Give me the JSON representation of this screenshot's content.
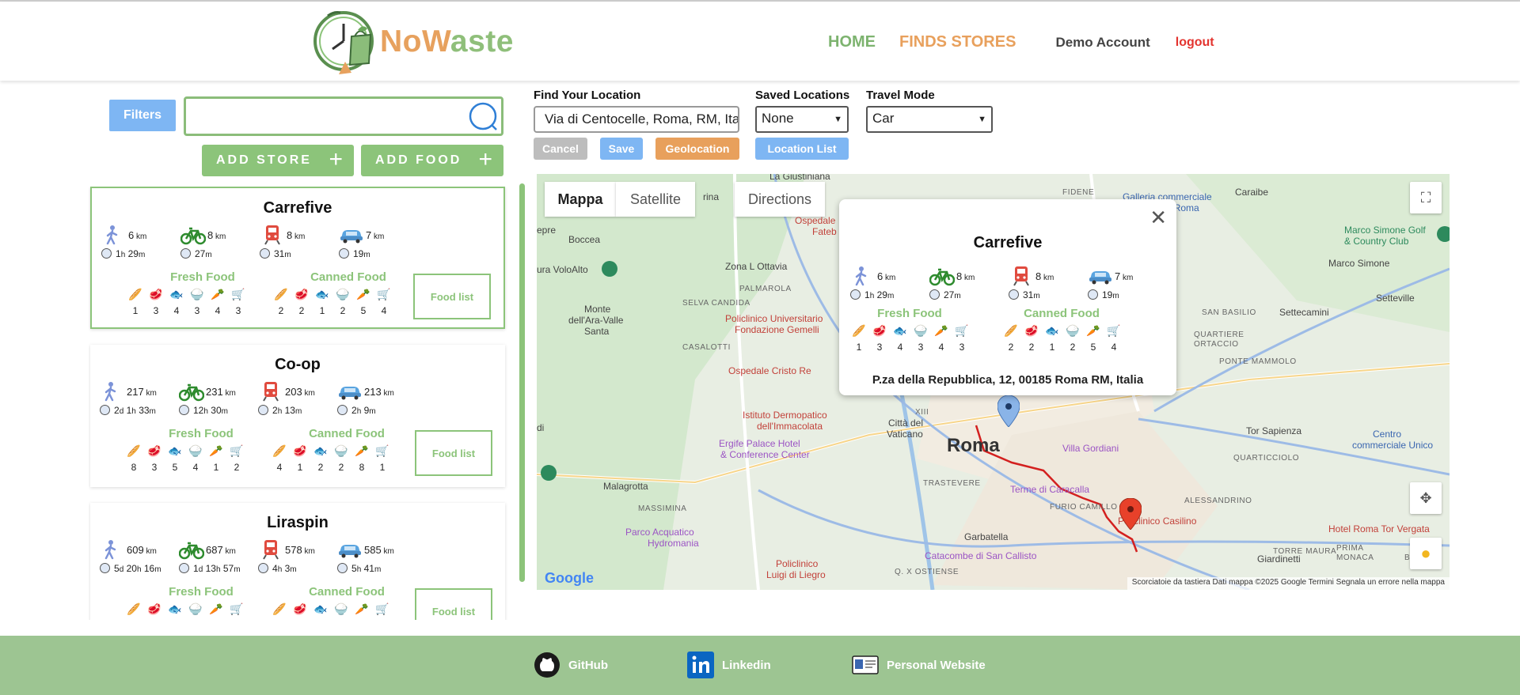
{
  "header": {
    "logo_part1": "No",
    "logo_part2": "W",
    "logo_part3": "aste",
    "nav_home": "HOME",
    "nav_finds": "FINDS STORES",
    "account": "Demo Account",
    "logout": "logout"
  },
  "sidebar": {
    "filters_label": "Filters",
    "search_value": "",
    "add_store": "ADD STORE",
    "add_food": "ADD FOOD",
    "food_list_label": "Food list",
    "fresh_label": "Fresh Food",
    "canned_label": "Canned Food"
  },
  "stores": [
    {
      "name": "Carrefive",
      "walk": {
        "d": "6",
        "u": "km",
        "t1": "1",
        "u1": "h",
        "t2": "29",
        "u2": "m",
        "t3": "",
        "u3": ""
      },
      "bike": {
        "d": "8",
        "u": "km",
        "t1": "27",
        "u1": "m",
        "t2": "",
        "u2": "",
        "t3": "",
        "u3": ""
      },
      "train": {
        "d": "8",
        "u": "km",
        "t1": "31",
        "u1": "m",
        "t2": "",
        "u2": "",
        "t3": "",
        "u3": ""
      },
      "car": {
        "d": "7",
        "u": "km",
        "t1": "19",
        "u1": "m",
        "t2": "",
        "u2": "",
        "t3": "",
        "u3": ""
      },
      "fresh": [
        "1",
        "3",
        "4",
        "3",
        "4",
        "3"
      ],
      "canned": [
        "2",
        "2",
        "1",
        "2",
        "5",
        "4"
      ]
    },
    {
      "name": "Co-op",
      "walk": {
        "d": "217",
        "u": "km",
        "t1": "2",
        "u1": "d",
        "t2": "1",
        "u2": "h",
        "t3": "33",
        "u3": "m"
      },
      "bike": {
        "d": "231",
        "u": "km",
        "t1": "12",
        "u1": "h",
        "t2": "30",
        "u2": "m",
        "t3": "",
        "u3": ""
      },
      "train": {
        "d": "203",
        "u": "km",
        "t1": "2",
        "u1": "h",
        "t2": "13",
        "u2": "m",
        "t3": "",
        "u3": ""
      },
      "car": {
        "d": "213",
        "u": "km",
        "t1": "2",
        "u1": "h",
        "t2": "9",
        "u2": "m",
        "t3": "",
        "u3": ""
      },
      "fresh": [
        "8",
        "3",
        "5",
        "4",
        "1",
        "2"
      ],
      "canned": [
        "4",
        "1",
        "2",
        "2",
        "8",
        "1"
      ]
    },
    {
      "name": "Liraspin",
      "walk": {
        "d": "609",
        "u": "km",
        "t1": "5",
        "u1": "d",
        "t2": "20",
        "u2": "h",
        "t3": "16",
        "u3": "m"
      },
      "bike": {
        "d": "687",
        "u": "km",
        "t1": "1",
        "u1": "d",
        "t2": "13",
        "u2": "h",
        "t3": "57",
        "u3": "m"
      },
      "train": {
        "d": "578",
        "u": "km",
        "t1": "4",
        "u1": "h",
        "t2": "3",
        "u2": "m",
        "t3": "",
        "u3": ""
      },
      "car": {
        "d": "585",
        "u": "km",
        "t1": "5",
        "u1": "h",
        "t2": "41",
        "u2": "m",
        "t3": "",
        "u3": ""
      },
      "fresh": [
        "",
        "",
        "",
        "",
        "",
        ""
      ],
      "canned": [
        "",
        "",
        "",
        "",
        "",
        ""
      ]
    }
  ],
  "location": {
    "find_label": "Find Your Location",
    "find_value": "Via di Centocelle, Roma, RM, Italia",
    "saved_label": "Saved Locations",
    "saved_value": "None",
    "travel_label": "Travel Mode",
    "travel_value": "Car",
    "cancel": "Cancel",
    "save": "Save",
    "geolocation": "Geolocation",
    "location_list": "Location List"
  },
  "map": {
    "tab_map": "Mappa",
    "tab_satellite": "Satellite",
    "tab_directions": "Directions",
    "popup": {
      "name": "Carrefive",
      "walk": {
        "d": "6",
        "u": "km",
        "t1": "1",
        "u1": "h",
        "t2": "29",
        "u2": "m"
      },
      "bike": {
        "d": "8",
        "u": "km",
        "t1": "27",
        "u1": "m"
      },
      "train": {
        "d": "8",
        "u": "km",
        "t1": "31",
        "u1": "m"
      },
      "car": {
        "d": "7",
        "u": "km",
        "t1": "19",
        "u1": "m"
      },
      "fresh": [
        "1",
        "3",
        "4",
        "3",
        "4",
        "3"
      ],
      "canned": [
        "2",
        "2",
        "1",
        "2",
        "5",
        "4"
      ],
      "address": "P.za della Repubblica, 12, 00185 Roma RM, Italia"
    },
    "labels": {
      "la_giustiniana": "La Giustiniana",
      "fidene": "FIDENE",
      "galleria": "Galleria commerciale",
      "galleria2": "Porta di Roma",
      "caraibe": "Caraibe",
      "marco_golf": "Marco Simone Golf",
      "marco_golf2": "& Country Club",
      "marco_simone": "Marco Simone",
      "setteville": "Setteville",
      "settecamini": "Settecamini",
      "san_basilio": "SAN BASILIO",
      "boccea": "Boccea",
      "volo": "ura VoloAlto",
      "zona": "Zona L Ottavia",
      "palmarola": "PALMAROLA",
      "selva": "SELVA CANDIDA",
      "monte1": "Monte",
      "monte2": "dell'Ara-Valle",
      "monte3": "Santa",
      "policlinico_g1": "Policlinico Universitario",
      "policlinico_g2": "Fondazione Gemelli",
      "casalotti": "CASALOTTI",
      "cristo": "Ospedale Cristo Re",
      "ospedale_fate1": "Ospedale",
      "ospedale_fate2": "Fateb",
      "istituto1": "Istituto Dermopatico",
      "istituto2": "dell'Immacolata",
      "ergife1": "Ergife Palace Hotel",
      "ergife2": "& Conference Center",
      "vaticano1": "Città del",
      "vaticano2": "Vaticano",
      "roma": "Roma",
      "villa": "Villa Gordiani",
      "tor_sapienza": "Tor Sapienza",
      "quarticciolo": "QUARTICCIOLO",
      "centro1": "Centro",
      "centro2": "commerciale Unico",
      "malagrotta": "Malagrotta",
      "massimina": "MASSIMINA",
      "trastevere": "TRASTEVERE",
      "terme": "Terme di Caracalla",
      "furio": "FURIO CAMILLO",
      "alessandrino": "ALESSANDRINO",
      "casilino": "Policlinico Casilino",
      "hotel_tor": "Hotel Roma Tor Vergata",
      "parco1": "Parco Acquatico",
      "parco2": "Hydromania",
      "garbatella": "Garbatella",
      "catacombe": "Catacombe di San Callisto",
      "giardinetti": "Giardinetti",
      "ostiense": "Q. X OSTIENSE",
      "policlinico_l1": "Policlinico",
      "policlinico_l2": "Luigi di Liegro",
      "prima": "PRIMA",
      "torre": "TORRE MAURA",
      "monaca": "MONACA",
      "borgh": "BORGH",
      "rina": "rina",
      "pre": "epre",
      "di": "di",
      "xiii": "XIII",
      "venti": "QUARTIERE",
      "venti2": "ORTACCIO",
      "ponte": "PONTE MAMMOLO",
      "google": "Google"
    },
    "attribution": "Scorciatoie da tastiera    Dati mappa ©2025 Google    Termini    Segnala un errore nella mappa"
  },
  "footer": {
    "github": "GitHub",
    "linkedin": "Linkedin",
    "website": "Personal Website"
  },
  "colors": {
    "brand_green": "#8cc47a",
    "brand_orange": "#e8a05c",
    "filter_blue": "#7eb6f3",
    "logout_red": "#e3342f",
    "footer_green": "#9dc592",
    "route_red": "#d3201f"
  },
  "icons": {
    "walk": "walking-person-icon",
    "bike": "bicycle-icon",
    "train": "train-icon",
    "car": "car-icon",
    "clock": "clock-icon",
    "foods": [
      "bread-icon",
      "meat-icon",
      "fish-icon",
      "rice-icon",
      "carrot-icon",
      "groceries-icon"
    ]
  }
}
